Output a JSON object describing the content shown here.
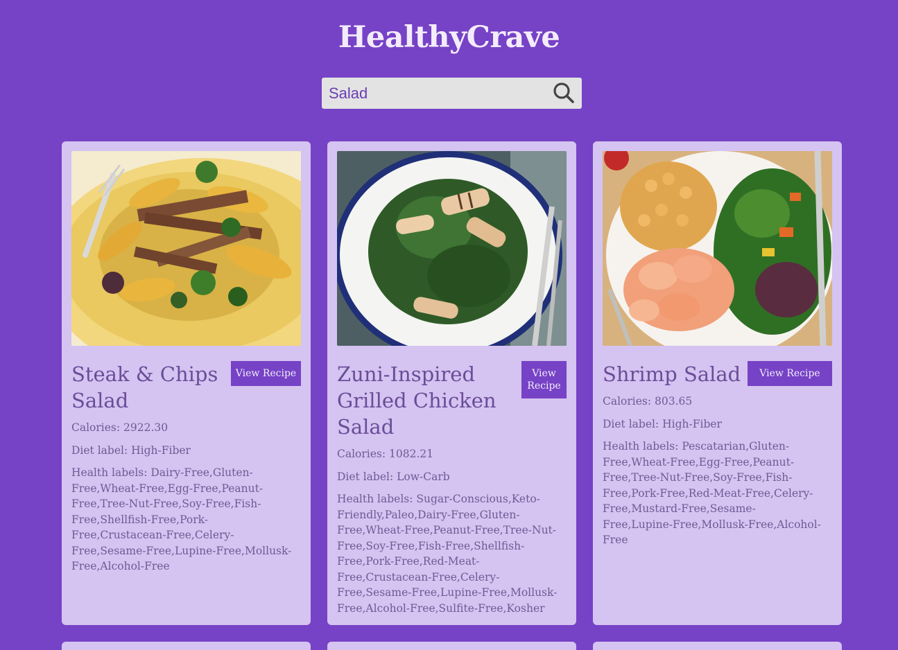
{
  "app": {
    "title": "HealthyCrave"
  },
  "search": {
    "value": "Salad",
    "icon": "search-icon"
  },
  "recipes": [
    {
      "title": "Steak & Chips Salad",
      "button": "View Recipe",
      "calories": "Calories: 2922.30",
      "diet": "Diet label: High-Fiber",
      "health": "Health labels: Dairy-Free,Gluten-Free,Wheat-Free,Egg-Free,Peanut-Free,Tree-Nut-Free,Soy-Free,Fish-Free,Shellfish-Free,Pork-Free,Crustacean-Free,Celery-Free,Sesame-Free,Lupine-Free,Mollusk-Free,Alcohol-Free"
    },
    {
      "title": "Zuni-Inspired Grilled Chicken Salad",
      "button": "View Recipe",
      "calories": "Calories: 1082.21",
      "diet": "Diet label: Low-Carb",
      "health": "Health labels: Sugar-Conscious,Keto-Friendly,Paleo,Dairy-Free,Gluten-Free,Wheat-Free,Peanut-Free,Tree-Nut-Free,Soy-Free,Fish-Free,Shellfish-Free,Pork-Free,Red-Meat-Free,Crustacean-Free,Celery-Free,Sesame-Free,Lupine-Free,Mollusk-Free,Alcohol-Free,Sulfite-Free,Kosher"
    },
    {
      "title": "Shrimp Salad",
      "button": "View Recipe",
      "calories": "Calories: 803.65",
      "diet": "Diet label: High-Fiber",
      "health": "Health labels: Pescatarian,Gluten-Free,Wheat-Free,Egg-Free,Peanut-Free,Tree-Nut-Free,Soy-Free,Fish-Free,Pork-Free,Red-Meat-Free,Celery-Free,Mustard-Free,Sesame-Free,Lupine-Free,Mollusk-Free,Alcohol-Free"
    }
  ],
  "colors": {
    "background": "#7642c6",
    "card": "#d5c3f1",
    "text": "#6a4d98",
    "button": "#7642c6"
  }
}
